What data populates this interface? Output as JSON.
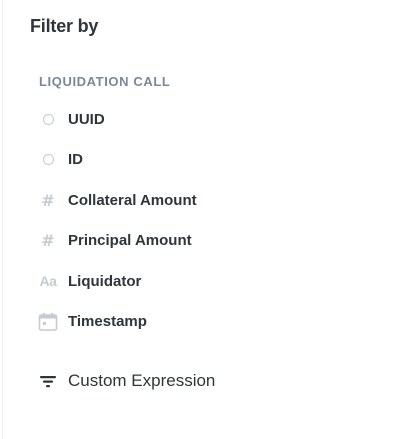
{
  "panel": {
    "title": "Filter by",
    "section_label": "LIQUIDATION CALL"
  },
  "fields": [
    {
      "label": "UUID",
      "icon": "circle-id-icon"
    },
    {
      "label": "ID",
      "icon": "circle-id-icon"
    },
    {
      "label": "Collateral Amount",
      "icon": "hash-icon"
    },
    {
      "label": "Principal Amount",
      "icon": "hash-icon"
    },
    {
      "label": "Liquidator",
      "icon": "text-aa-icon"
    },
    {
      "label": "Timestamp",
      "icon": "calendar-icon"
    }
  ],
  "custom_expression": {
    "label": "Custom Expression",
    "icon": "filter-lines-icon"
  },
  "colors": {
    "text": "#2e353b",
    "muted": "#7a8899",
    "icon": "#c5cbd2"
  }
}
